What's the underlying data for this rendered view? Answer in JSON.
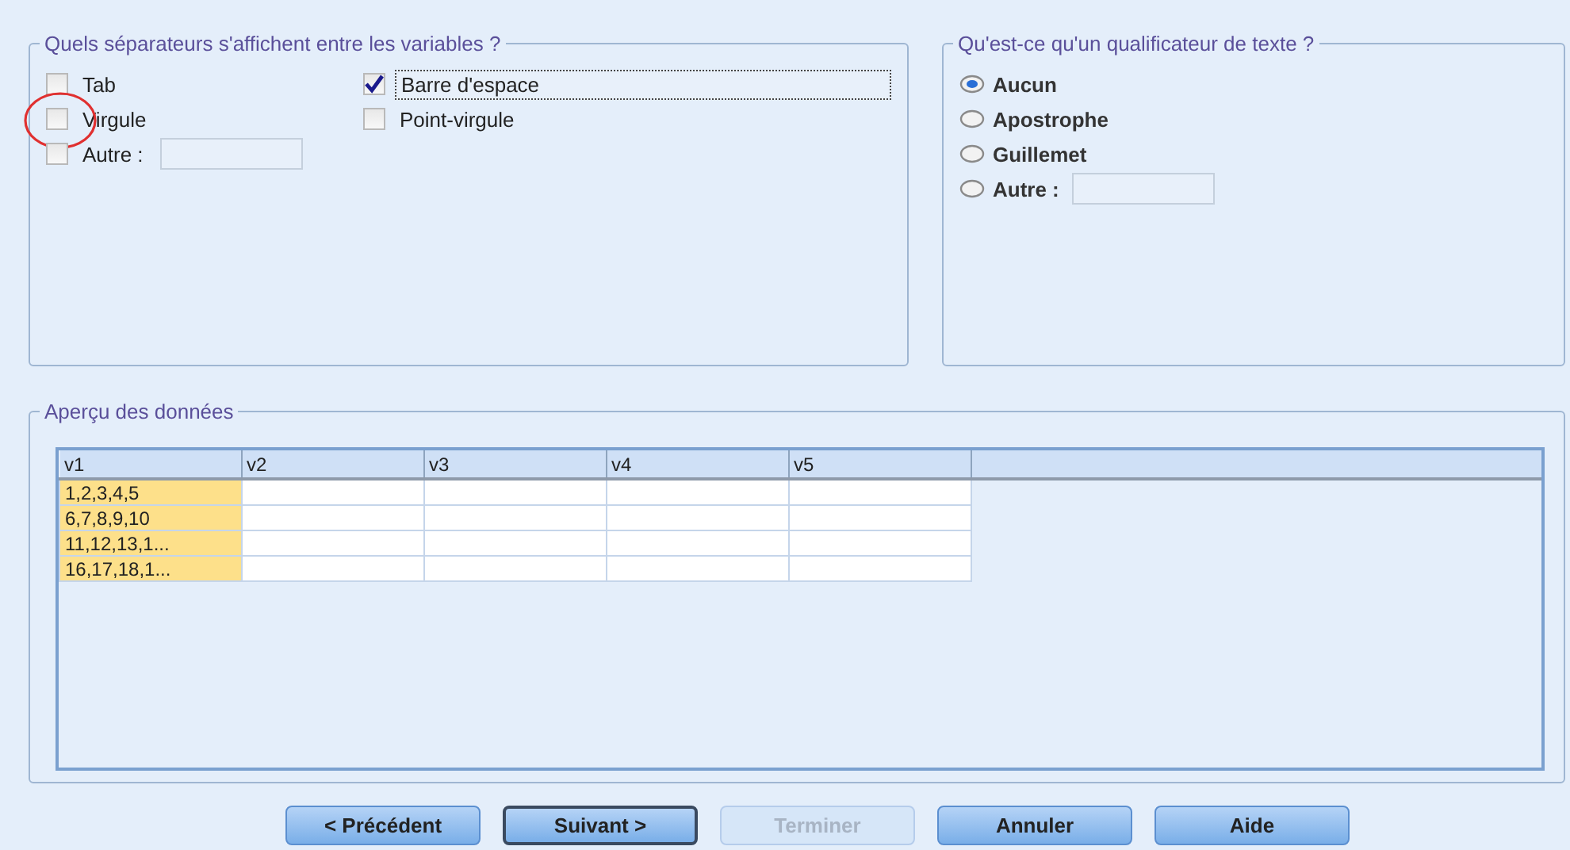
{
  "separators": {
    "title": "Quels séparateurs s'affichent entre les variables ?",
    "options": [
      {
        "label": "Tab",
        "checked": false,
        "highlighted": false
      },
      {
        "label": "Barre d'espace",
        "checked": true,
        "highlighted": false
      },
      {
        "label": "Virgule",
        "checked": false,
        "highlighted": true
      },
      {
        "label": "Point-virgule",
        "checked": false,
        "highlighted": false
      }
    ],
    "other": {
      "label": "Autre :",
      "checked": false
    }
  },
  "qualifier": {
    "title": "Qu'est-ce qu'un qualificateur de texte ?",
    "options": [
      {
        "label": "Aucun",
        "selected": true
      },
      {
        "label": "Apostrophe",
        "selected": false
      },
      {
        "label": "Guillemet",
        "selected": false
      },
      {
        "label": "Autre :",
        "selected": false
      }
    ]
  },
  "preview": {
    "title": "Aperçu des données",
    "columns": [
      "v1",
      "v2",
      "v3",
      "v4",
      "v5"
    ],
    "rows": [
      [
        "1,2,3,4,5",
        "",
        "",
        "",
        ""
      ],
      [
        "6,7,8,9,10",
        "",
        "",
        "",
        ""
      ],
      [
        "11,12,13,1...",
        "",
        "",
        "",
        ""
      ],
      [
        "16,17,18,1...",
        "",
        "",
        "",
        ""
      ]
    ]
  },
  "buttons": [
    {
      "label": "< Précédent",
      "disabled": false,
      "focused": false
    },
    {
      "label": "Suivant >",
      "disabled": false,
      "focused": true
    },
    {
      "label": "Terminer",
      "disabled": true,
      "focused": false
    },
    {
      "label": "Annuler",
      "disabled": false,
      "focused": false
    },
    {
      "label": "Aide",
      "disabled": false,
      "focused": false
    }
  ]
}
